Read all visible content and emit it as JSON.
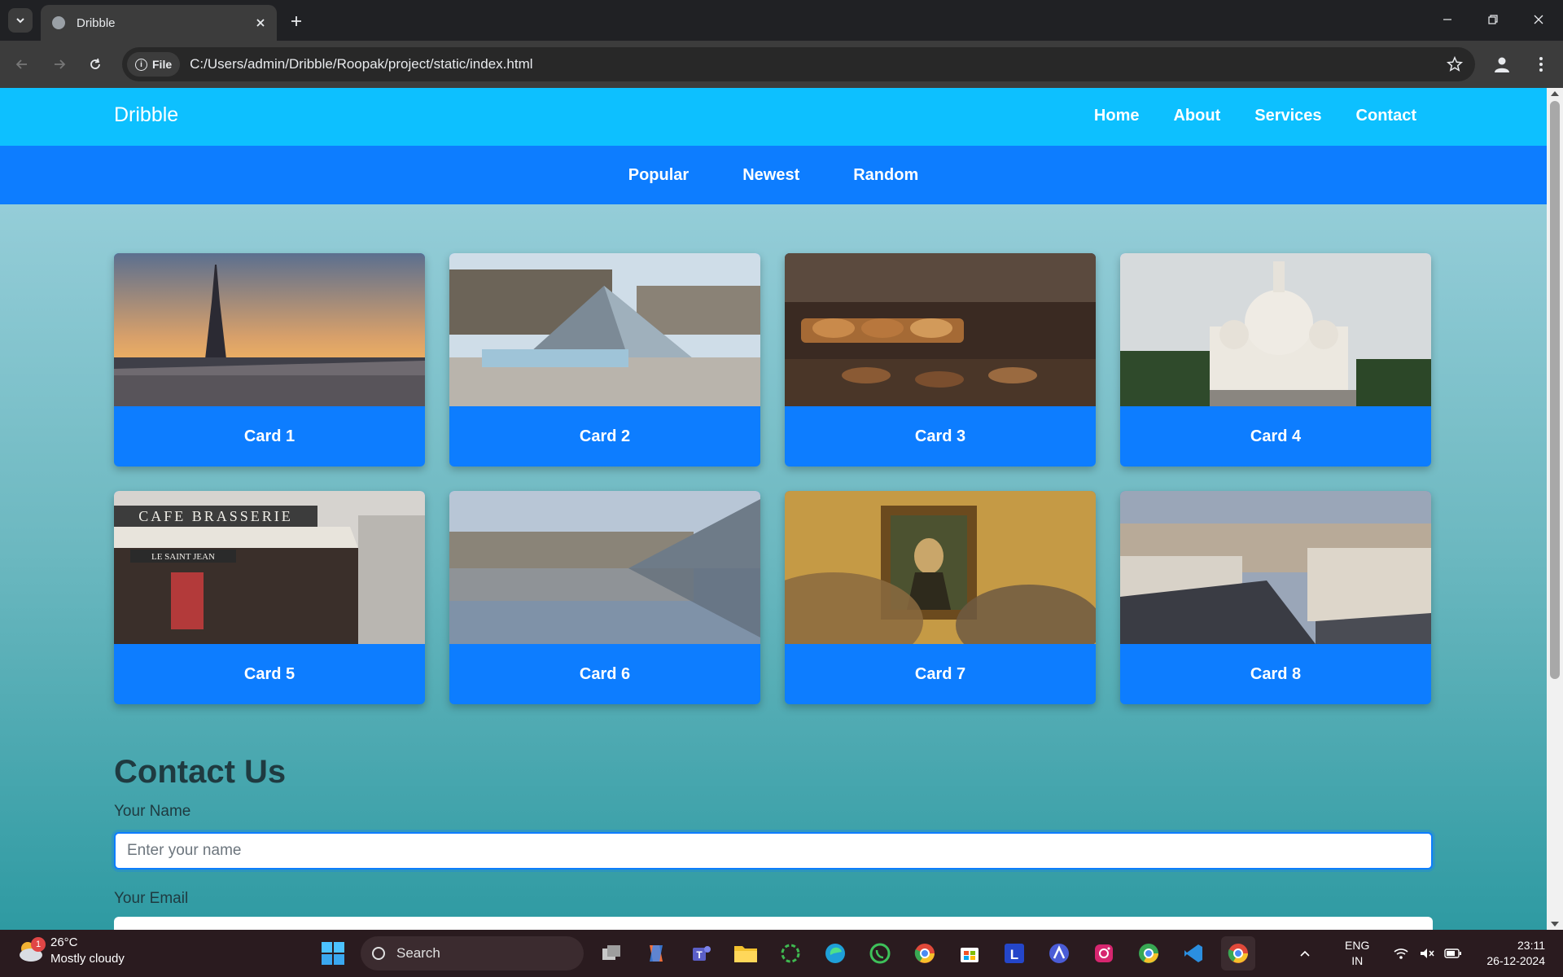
{
  "browser": {
    "tab_title": "Dribble",
    "url_chip": "File",
    "url": "C:/Users/admin/Dribble/Roopak/project/static/index.html"
  },
  "site": {
    "brand": "Dribble",
    "nav": [
      "Home",
      "About",
      "Services",
      "Contact"
    ],
    "filters": [
      "Popular",
      "Newest",
      "Random"
    ],
    "cards": [
      {
        "label": "Card 1",
        "image": "eiffel-tower-sunset"
      },
      {
        "label": "Card 2",
        "image": "louvre-pyramid"
      },
      {
        "label": "Card 3",
        "image": "bakery-pastries"
      },
      {
        "label": "Card 4",
        "image": "sacre-coeur"
      },
      {
        "label": "Card 5",
        "image": "cafe-brasserie"
      },
      {
        "label": "Card 6",
        "image": "louvre-reflection"
      },
      {
        "label": "Card 7",
        "image": "mona-lisa"
      },
      {
        "label": "Card 8",
        "image": "paris-rooftops"
      }
    ],
    "contact": {
      "title": "Contact Us",
      "name_label": "Your Name",
      "name_placeholder": "Enter your name",
      "email_label": "Your Email"
    }
  },
  "taskbar": {
    "weather_temp": "26°C",
    "weather_desc": "Mostly cloudy",
    "weather_badge": "1",
    "search_label": "Search",
    "lang_top": "ENG",
    "lang_bottom": "IN",
    "time": "23:11",
    "date": "26-12-2024"
  },
  "colors": {
    "nav_bg": "#0dc0ff",
    "filter_bg": "#0d7dff",
    "card_caption_bg": "#0d7dff"
  }
}
